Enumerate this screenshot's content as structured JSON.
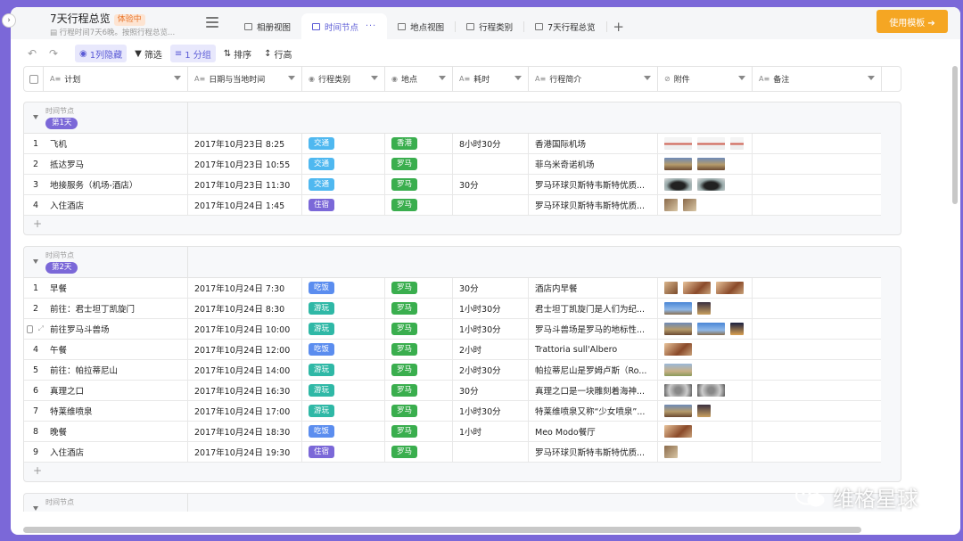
{
  "header": {
    "title": "7天行程总览",
    "trial_badge": "体验中",
    "subtitle": "行程时间7天6晚。按照行程总览...",
    "tabs": [
      {
        "label": "相册视图",
        "active": false
      },
      {
        "label": "时间节点",
        "active": true
      },
      {
        "label": "地点视图",
        "active": false
      },
      {
        "label": "行程类别",
        "active": false
      },
      {
        "label": "7天行程总览",
        "active": false
      }
    ],
    "add_tab": "+",
    "use_template": "使用模板 ➔"
  },
  "toolbar": {
    "undo": "↶",
    "redo": "↷",
    "hidden": "1列隐藏",
    "filter": "筛选",
    "group": "1 分组",
    "sort": "排序",
    "row_height": "行高"
  },
  "columns": [
    {
      "label": "计划",
      "icon": "text-icon"
    },
    {
      "label": "日期与当地时间",
      "icon": "text-icon"
    },
    {
      "label": "行程类别",
      "icon": "option-icon"
    },
    {
      "label": "地点",
      "icon": "option-icon"
    },
    {
      "label": "耗时",
      "icon": "text-icon"
    },
    {
      "label": "行程简介",
      "icon": "text-icon"
    },
    {
      "label": "附件",
      "icon": "attachment-icon"
    },
    {
      "label": "备注",
      "icon": "text-icon"
    }
  ],
  "group_field": "时间节点",
  "colors": {
    "交通": "#4fb8f0",
    "住宿": "#7b68d8",
    "吃饭": "#5b8def",
    "游玩": "#2fb8a6",
    "香港": "#3aae4e",
    "罗马": "#3aae4e"
  },
  "groups": [
    {
      "label": "第1天",
      "rows": [
        {
          "num": "1",
          "plan": "飞机",
          "date": "2017年10月23日 8:25",
          "category": "交通",
          "place": "香港",
          "duration": "8小时30分",
          "intro": "香港国际机场",
          "thumbs": [
            "plane",
            "plane",
            "plane-sm"
          ]
        },
        {
          "num": "2",
          "plan": "抵达罗马",
          "date": "2017年10月23日 10:55",
          "category": "交通",
          "place": "罗马",
          "duration": "",
          "intro": "菲乌米奇诺机场",
          "thumbs": [
            "city",
            "city"
          ]
        },
        {
          "num": "3",
          "plan": "地接服务（机场-酒店）",
          "date": "2017年10月23日 11:30",
          "category": "交通",
          "place": "罗马",
          "duration": "30分",
          "intro": "罗马环球贝斯特韦斯特优质...",
          "thumbs": [
            "car",
            "car"
          ]
        },
        {
          "num": "4",
          "plan": "入住酒店",
          "date": "2017年10月24日 1:45",
          "category": "住宿",
          "place": "罗马",
          "duration": "",
          "intro": "罗马环球贝斯特韦斯特优质...",
          "thumbs": [
            "room-sm",
            "room-sm"
          ]
        }
      ],
      "add": "+"
    },
    {
      "label": "第2天",
      "rows": [
        {
          "num": "1",
          "plan": "早餐",
          "date": "2017年10月24日 7:30",
          "category": "吃饭",
          "place": "罗马",
          "duration": "30分",
          "intro": "酒店内早餐",
          "thumbs": [
            "food-sm",
            "food",
            "food"
          ]
        },
        {
          "num": "2",
          "plan": "前往：君士坦丁凯旋门",
          "date": "2017年10月24日 8:30",
          "category": "游玩",
          "place": "罗马",
          "duration": "1小时30分",
          "intro": "君士坦丁凯旋门是人们为纪...",
          "thumbs": [
            "sky",
            "arch-sm"
          ]
        },
        {
          "num": "",
          "plan": "前往罗马斗兽场",
          "date": "2017年10月24日 10:00",
          "category": "游玩",
          "place": "罗马",
          "duration": "1小时30分",
          "intro": "罗马斗兽场是罗马的地标性...",
          "thumbs": [
            "city",
            "sky",
            "night-sm"
          ]
        },
        {
          "num": "4",
          "plan": "午餐",
          "date": "2017年10月24日 12:00",
          "category": "吃饭",
          "place": "罗马",
          "duration": "2小时",
          "intro": "Trattoria sull'Albero",
          "thumbs": [
            "food"
          ]
        },
        {
          "num": "5",
          "plan": "前往：帕拉蒂尼山",
          "date": "2017年10月24日 14:00",
          "category": "游玩",
          "place": "罗马",
          "duration": "2小时30分",
          "intro": "帕拉蒂尼山是罗姆卢斯（Ro...",
          "thumbs": [
            "ruin"
          ]
        },
        {
          "num": "6",
          "plan": "真理之口",
          "date": "2017年10月24日 16:30",
          "category": "游玩",
          "place": "罗马",
          "duration": "30分",
          "intro": "真理之口是一块雕刻着海神...",
          "thumbs": [
            "stone",
            "stone"
          ]
        },
        {
          "num": "7",
          "plan": "特莱维喷泉",
          "date": "2017年10月24日 17:00",
          "category": "游玩",
          "place": "罗马",
          "duration": "1小时30分",
          "intro": "特莱维喷泉又称“少女喷泉”...",
          "thumbs": [
            "city",
            "arch-sm"
          ]
        },
        {
          "num": "8",
          "plan": "晚餐",
          "date": "2017年10月24日 18:30",
          "category": "吃饭",
          "place": "罗马",
          "duration": "1小时",
          "intro": "Meo Modo餐厅",
          "thumbs": [
            "food"
          ]
        },
        {
          "num": "9",
          "plan": "入住酒店",
          "date": "2017年10月24日 19:30",
          "category": "住宿",
          "place": "罗马",
          "duration": "",
          "intro": "罗马环球贝斯特韦斯特优质...",
          "thumbs": [
            "room-sm"
          ]
        }
      ],
      "add": "+"
    },
    {
      "label": "",
      "rows": [],
      "add": ""
    }
  ],
  "watermark": "维格星球"
}
